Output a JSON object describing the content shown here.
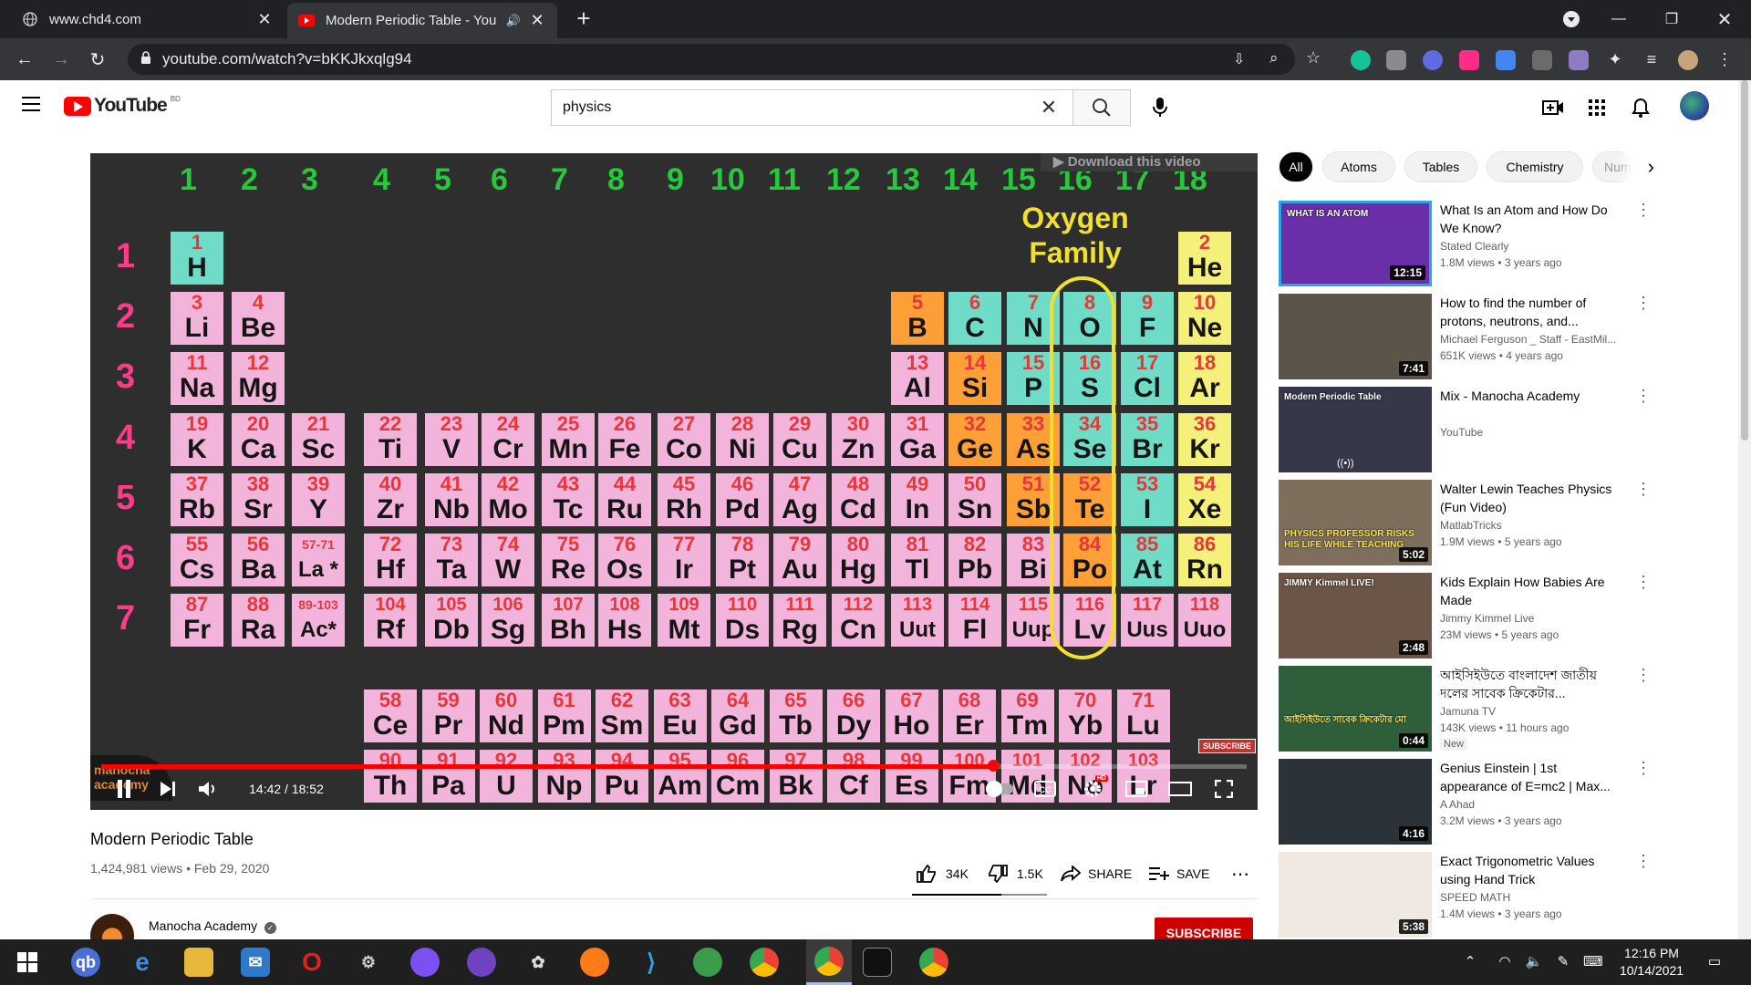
{
  "browser": {
    "tabs": [
      {
        "title": "www.chd4.com",
        "active": false
      },
      {
        "title": "Modern Periodic Table - You",
        "active": true
      }
    ],
    "url": "youtube.com/watch?v=bKKJkxqlg94"
  },
  "youtube": {
    "logo_text": "YouTube",
    "country_code": "BD",
    "search_query": "physics"
  },
  "player": {
    "time": "14:42 / 18:52",
    "progress": 0.779,
    "download_banner": "Download this video",
    "watermark": "manocha academy",
    "subscribe_watermark": "SUBSCRIBE",
    "hd_badge": "HD"
  },
  "periodic_table": {
    "groups": [
      "1",
      "2",
      "3",
      "4",
      "5",
      "6",
      "7",
      "8",
      "9",
      "10",
      "11",
      "12",
      "13",
      "14",
      "15",
      "16",
      "17",
      "18"
    ],
    "periods": [
      "1",
      "2",
      "3",
      "4",
      "5",
      "6",
      "7"
    ],
    "highlight_label": "Oxygen Family",
    "rows": [
      [
        [
          "1",
          "H",
          "teal"
        ]
      ],
      [
        [
          "3",
          "Li",
          "pink"
        ],
        [
          "4",
          "Be",
          "pink"
        ],
        [
          "5",
          "B",
          "orange"
        ],
        [
          "6",
          "C",
          "teal"
        ],
        [
          "7",
          "N",
          "teal"
        ],
        [
          "8",
          "O",
          "teal"
        ],
        [
          "9",
          "F",
          "teal"
        ],
        [
          "10",
          "Ne",
          "yellow"
        ]
      ],
      [
        [
          "11",
          "Na",
          "pink"
        ],
        [
          "12",
          "Mg",
          "pink"
        ],
        [
          "13",
          "Al",
          "pink"
        ],
        [
          "14",
          "Si",
          "orange"
        ],
        [
          "15",
          "P",
          "teal"
        ],
        [
          "16",
          "S",
          "teal"
        ],
        [
          "17",
          "Cl",
          "teal"
        ],
        [
          "18",
          "Ar",
          "yellow"
        ]
      ],
      [
        [
          "19",
          "K",
          "pink"
        ],
        [
          "20",
          "Ca",
          "pink"
        ],
        [
          "21",
          "Sc",
          "pink"
        ],
        [
          "22",
          "Ti",
          "pink"
        ],
        [
          "23",
          "V",
          "pink"
        ],
        [
          "24",
          "Cr",
          "pink"
        ],
        [
          "25",
          "Mn",
          "pink"
        ],
        [
          "26",
          "Fe",
          "pink"
        ],
        [
          "27",
          "Co",
          "pink"
        ],
        [
          "28",
          "Ni",
          "pink"
        ],
        [
          "29",
          "Cu",
          "pink"
        ],
        [
          "30",
          "Zn",
          "pink"
        ],
        [
          "31",
          "Ga",
          "pink"
        ],
        [
          "32",
          "Ge",
          "orange"
        ],
        [
          "33",
          "As",
          "orange"
        ],
        [
          "34",
          "Se",
          "teal"
        ],
        [
          "35",
          "Br",
          "teal"
        ],
        [
          "36",
          "Kr",
          "yellow"
        ]
      ],
      [
        [
          "37",
          "Rb",
          "pink"
        ],
        [
          "38",
          "Sr",
          "pink"
        ],
        [
          "39",
          "Y",
          "pink"
        ],
        [
          "40",
          "Zr",
          "pink"
        ],
        [
          "41",
          "Nb",
          "pink"
        ],
        [
          "42",
          "Mo",
          "pink"
        ],
        [
          "43",
          "Tc",
          "pink"
        ],
        [
          "44",
          "Ru",
          "pink"
        ],
        [
          "45",
          "Rh",
          "pink"
        ],
        [
          "46",
          "Pd",
          "pink"
        ],
        [
          "47",
          "Ag",
          "pink"
        ],
        [
          "48",
          "Cd",
          "pink"
        ],
        [
          "49",
          "In",
          "pink"
        ],
        [
          "50",
          "Sn",
          "pink"
        ],
        [
          "51",
          "Sb",
          "orange"
        ],
        [
          "52",
          "Te",
          "orange"
        ],
        [
          "53",
          "I",
          "teal"
        ],
        [
          "54",
          "Xe",
          "yellow"
        ]
      ],
      [
        [
          "55",
          "Cs",
          "pink"
        ],
        [
          "56",
          "Ba",
          "pink"
        ],
        [
          "57-71",
          "La *",
          "pink"
        ],
        [
          "72",
          "Hf",
          "pink"
        ],
        [
          "73",
          "Ta",
          "pink"
        ],
        [
          "74",
          "W",
          "pink"
        ],
        [
          "75",
          "Re",
          "pink"
        ],
        [
          "76",
          "Os",
          "pink"
        ],
        [
          "77",
          "Ir",
          "pink"
        ],
        [
          "78",
          "Pt",
          "pink"
        ],
        [
          "79",
          "Au",
          "pink"
        ],
        [
          "80",
          "Hg",
          "pink"
        ],
        [
          "81",
          "Tl",
          "pink"
        ],
        [
          "82",
          "Pb",
          "pink"
        ],
        [
          "83",
          "Bi",
          "pink"
        ],
        [
          "84",
          "Po",
          "orange"
        ],
        [
          "85",
          "At",
          "teal"
        ],
        [
          "86",
          "Rn",
          "yellow"
        ]
      ],
      [
        [
          "87",
          "Fr",
          "pink"
        ],
        [
          "88",
          "Ra",
          "pink"
        ],
        [
          "89-103",
          "Ac*",
          "pink"
        ],
        [
          "104",
          "Rf",
          "pink"
        ],
        [
          "105",
          "Db",
          "pink"
        ],
        [
          "106",
          "Sg",
          "pink"
        ],
        [
          "107",
          "Bh",
          "pink"
        ],
        [
          "108",
          "Hs",
          "pink"
        ],
        [
          "109",
          "Mt",
          "pink"
        ],
        [
          "110",
          "Ds",
          "pink"
        ],
        [
          "111",
          "Rg",
          "pink"
        ],
        [
          "112",
          "Cn",
          "pink"
        ],
        [
          "113",
          "Uut",
          "pink"
        ],
        [
          "114",
          "Fl",
          "pink"
        ],
        [
          "115",
          "Uup",
          "pink"
        ],
        [
          "116",
          "Lv",
          "pink"
        ],
        [
          "117",
          "Uus",
          "pink"
        ],
        [
          "118",
          "Uuo",
          "pink"
        ]
      ]
    ],
    "lanthanides": [
      [
        "58",
        "Ce"
      ],
      [
        "59",
        "Pr"
      ],
      [
        "60",
        "Nd"
      ],
      [
        "61",
        "Pm"
      ],
      [
        "62",
        "Sm"
      ],
      [
        "63",
        "Eu"
      ],
      [
        "64",
        "Gd"
      ],
      [
        "65",
        "Tb"
      ],
      [
        "66",
        "Dy"
      ],
      [
        "67",
        "Ho"
      ],
      [
        "68",
        "Er"
      ],
      [
        "69",
        "Tm"
      ],
      [
        "70",
        "Yb"
      ],
      [
        "71",
        "Lu"
      ]
    ],
    "actinides": [
      [
        "90",
        "Th"
      ],
      [
        "91",
        "Pa"
      ],
      [
        "92",
        "U"
      ],
      [
        "93",
        "Np"
      ],
      [
        "94",
        "Pu"
      ],
      [
        "95",
        "Am"
      ],
      [
        "96",
        "Cm"
      ],
      [
        "97",
        "Bk"
      ],
      [
        "98",
        "Cf"
      ],
      [
        "99",
        "Es"
      ],
      [
        "100",
        "Fm"
      ],
      [
        "101",
        "Md"
      ],
      [
        "102",
        "No"
      ],
      [
        "103",
        "Lr"
      ]
    ]
  },
  "video": {
    "title": "Modern Periodic Table",
    "meta": "1,424,981 views • Feb 29, 2020",
    "likes": "34K",
    "dislikes": "1.5K",
    "share": "SHARE",
    "save": "SAVE",
    "channel": "Manocha Academy",
    "subscribe": "SUBSCRIBE"
  },
  "chips": [
    "All",
    "Atoms",
    "Tables",
    "Chemistry",
    "Numi"
  ],
  "recommendations": [
    {
      "title": "What Is an Atom and How Do We Know?",
      "channel": "Stated Clearly",
      "meta": "1.8M views • 3 years ago",
      "duration": "12:15",
      "thumb_text": "WHAT IS AN ATOM",
      "thumb_color": "#6a2fa8"
    },
    {
      "title": "How to find the number of protons, neutrons, and...",
      "channel": "Michael Ferguson _ Staff - EastMil...",
      "meta": "651K views • 4 years ago",
      "duration": "7:41",
      "thumb_text": "",
      "thumb_color": "#5a5449"
    },
    {
      "title": "Mix - Manocha Academy",
      "channel": "YouTube",
      "meta": "",
      "duration": "",
      "thumb_text": "Modern Periodic Table",
      "thumb_color": "#37374a"
    },
    {
      "title": "Walter Lewin Teaches Physics (Fun Video)",
      "channel": "MatlabTricks",
      "meta": "1.9M views • 5 years ago",
      "duration": "5:02",
      "thumb_text": "PHYSICS PROFESSOR RISKS HIS LIFE WHILE TEACHING",
      "thumb_color": "#7d6f5c"
    },
    {
      "title": "Kids Explain How Babies Are Made",
      "channel": "Jimmy Kimmel Live",
      "meta": "23M views • 5 years ago",
      "duration": "2:48",
      "thumb_text": "JIMMY Kimmel LIVE!",
      "thumb_color": "#6b5546"
    },
    {
      "title": "আইসিইউতে বাংলাদেশ জাতীয় দলের সাবেক ক্রিকেটার...",
      "channel": "Jamuna TV",
      "meta": "143K views • 11 hours ago",
      "duration": "0:44",
      "thumb_text": "আইসিইউতে সাবেক ক্রিকেটার মো",
      "thumb_color": "#2f5f3a",
      "badge": "New"
    },
    {
      "title": "Genius Einstein | 1st appearance of E=mc2 | Max...",
      "channel": "A Ahad",
      "meta": "3.2M views • 3 years ago",
      "duration": "4:16",
      "thumb_text": "",
      "thumb_color": "#2b3238"
    },
    {
      "title": "Exact Trigonometric Values using Hand Trick",
      "channel": "SPEED MATH",
      "meta": "1.4M views • 3 years ago",
      "duration": "5:38",
      "thumb_text": "",
      "thumb_color": "#efe9e2"
    }
  ],
  "taskbar": {
    "time": "12:16 PM",
    "date": "10/14/2021"
  },
  "colors": {
    "teal": "#6fdcc8",
    "pink": "#f3b4dc",
    "orange": "#ff9f38",
    "yellow": "#f4f07a",
    "youtube_red": "#ff0000",
    "subscribe_red": "#cc0000"
  }
}
